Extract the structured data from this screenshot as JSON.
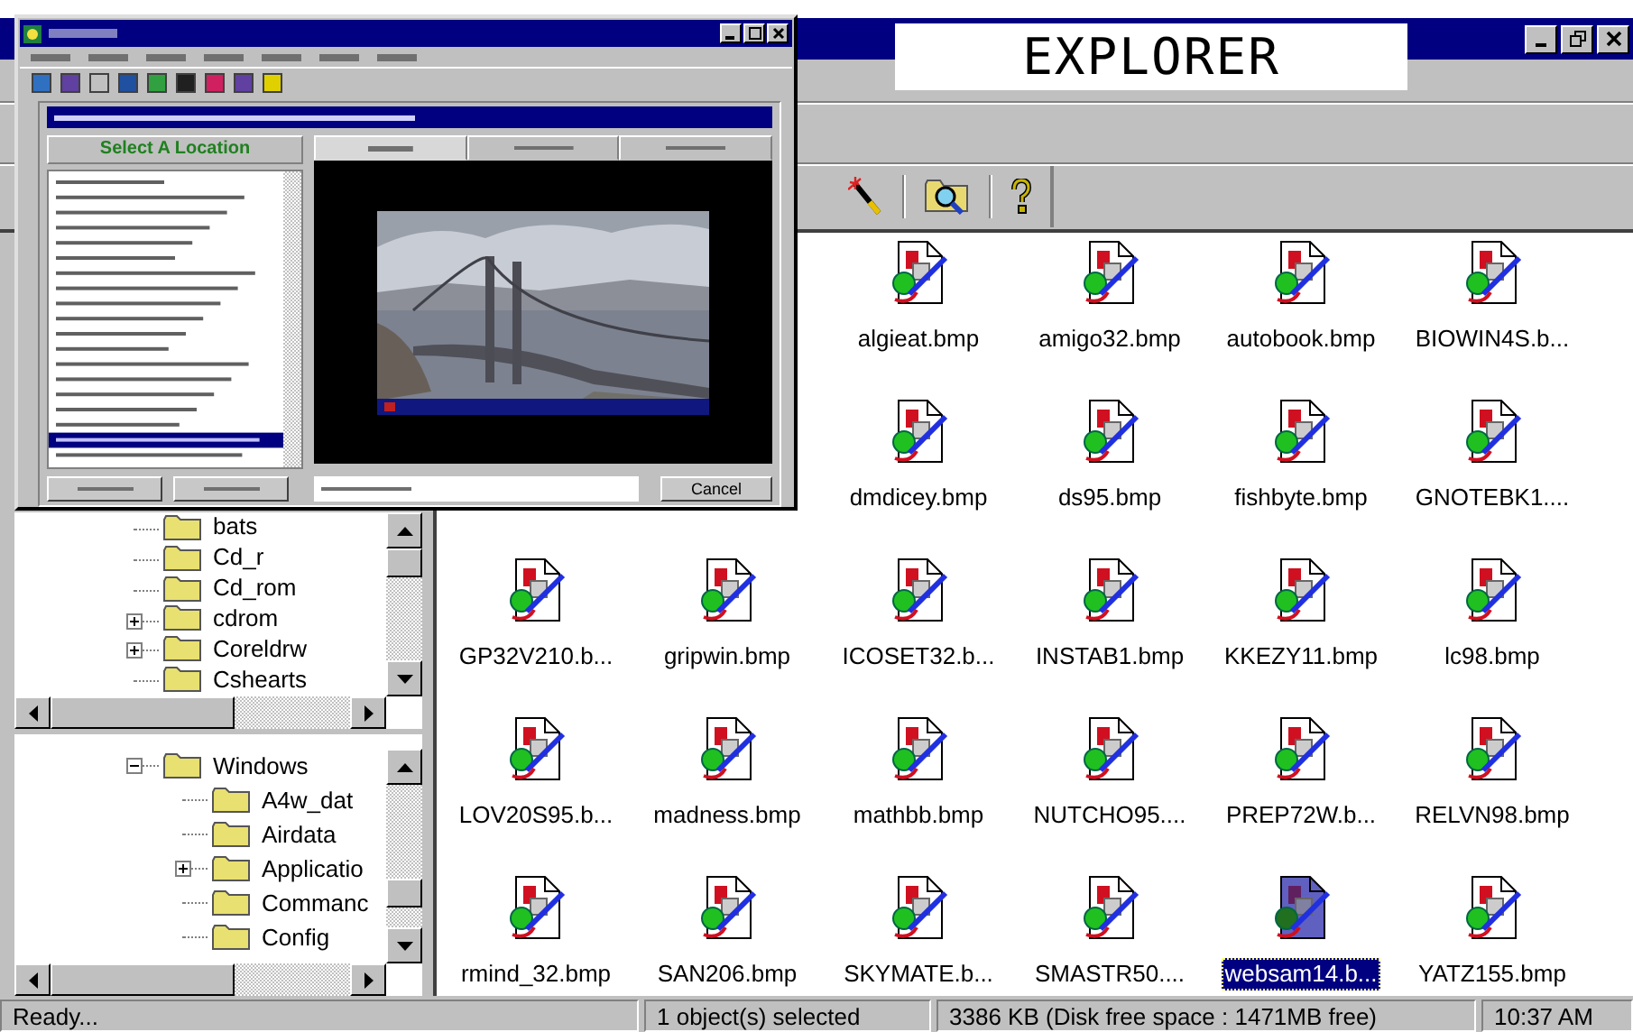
{
  "explorer": {
    "title": "EXPLORER",
    "tree_top": [
      {
        "label": "bats"
      },
      {
        "label": "Cd_r"
      },
      {
        "label": "Cd_rom"
      },
      {
        "label": "cdrom",
        "expanded": false
      },
      {
        "label": "Coreldrw",
        "expanded": false
      },
      {
        "label": "Cshearts"
      }
    ],
    "tree_bottom": [
      {
        "label": "Windows",
        "expanded": true,
        "children": [
          {
            "label": "A4w_dat"
          },
          {
            "label": "Airdata"
          },
          {
            "label": "Applicatio",
            "expanded": false
          },
          {
            "label": "Commanc"
          },
          {
            "label": "Config"
          }
        ]
      }
    ],
    "file_rows": [
      [
        {
          "name": "algieat.bmp",
          "selected": false
        },
        {
          "name": "amigo32.bmp",
          "selected": false
        },
        {
          "name": "autobook.bmp",
          "selected": false
        },
        {
          "name": "BIOWIN4S.b...",
          "selected": false
        }
      ],
      [
        {
          "name": "dmdicey.bmp",
          "selected": false
        },
        {
          "name": "ds95.bmp",
          "selected": false
        },
        {
          "name": "fishbyte.bmp",
          "selected": false
        },
        {
          "name": "GNOTEBK1....",
          "selected": false
        }
      ],
      [
        {
          "name": "GP32V210.b...",
          "selected": false
        },
        {
          "name": "gripwin.bmp",
          "selected": false
        },
        {
          "name": "ICOSET32.b...",
          "selected": false
        },
        {
          "name": "INSTAB1.bmp",
          "selected": false
        },
        {
          "name": "KKEZY11.bmp",
          "selected": false
        },
        {
          "name": "lc98.bmp",
          "selected": false
        }
      ],
      [
        {
          "name": "LOV20S95.b...",
          "selected": false
        },
        {
          "name": "madness.bmp",
          "selected": false
        },
        {
          "name": "mathbb.bmp",
          "selected": false
        },
        {
          "name": "NUTCHO95....",
          "selected": false
        },
        {
          "name": "PREP72W.b...",
          "selected": false
        },
        {
          "name": "RELVN98.bmp",
          "selected": false
        }
      ],
      [
        {
          "name": "rmind_32.bmp",
          "selected": false
        },
        {
          "name": "SAN206.bmp",
          "selected": false
        },
        {
          "name": "SKYMATE.b...",
          "selected": false
        },
        {
          "name": "SMASTR50....",
          "selected": false
        },
        {
          "name": "websam14.b...",
          "selected": true
        },
        {
          "name": "YATZ155.bmp",
          "selected": false
        }
      ]
    ],
    "status_bar": [
      "Ready...",
      "1 object(s) selected",
      "3386 KB (Disk free space : 1471MB free)",
      "10:37 AM"
    ]
  },
  "webcam": {
    "location_header": "Select A Location",
    "tabs": [
      {
        "selected": true
      },
      {
        "selected": false
      },
      {
        "selected": false
      }
    ],
    "locations": [
      {
        "selected": false
      },
      {
        "selected": false
      },
      {
        "selected": false
      },
      {
        "selected": false
      },
      {
        "selected": false
      },
      {
        "selected": false
      },
      {
        "selected": false
      },
      {
        "selected": false
      },
      {
        "selected": false
      },
      {
        "selected": false
      },
      {
        "selected": false
      },
      {
        "selected": false
      },
      {
        "selected": false
      },
      {
        "selected": false
      },
      {
        "selected": false
      },
      {
        "selected": false
      },
      {
        "selected": false
      },
      {
        "selected": true
      },
      {
        "selected": false
      }
    ],
    "cancel_label": "Cancel"
  }
}
